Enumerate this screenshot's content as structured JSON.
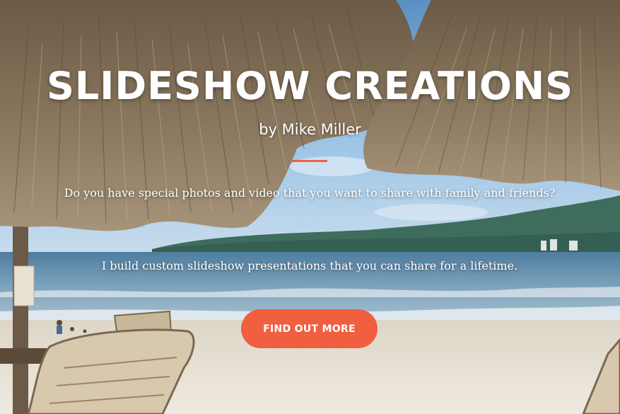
{
  "hero": {
    "title": "SLIDESHOW CREATIONS",
    "byline": "by Mike Miller",
    "lead": "Do you have special photos and video that you want to share with family and friends?",
    "lead2": "I build custom slideshow presentations that you can share for a lifetime.",
    "cta_label": "FIND OUT MORE"
  },
  "colors": {
    "accent": "#f05f40",
    "text": "#ffffff",
    "sky": "#7fb0da",
    "sea": "#6b93b0",
    "sand": "#e8e2d6"
  },
  "background": {
    "scene": "beach-with-palapa-umbrellas-photo"
  }
}
